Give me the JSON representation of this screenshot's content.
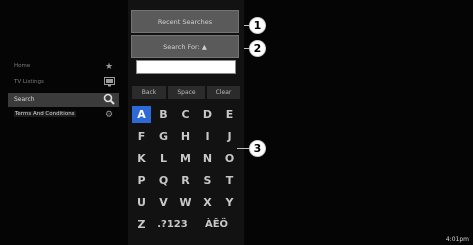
{
  "sidebar": {
    "items": [
      {
        "label": "Home",
        "icon": "star-icon"
      },
      {
        "label": "TV Listings",
        "icon": "tv-icon"
      },
      {
        "label": "Search",
        "icon": "magnifier-icon"
      },
      {
        "label": "Terms And Conditions",
        "icon": "settings-gear-icon"
      }
    ]
  },
  "panel": {
    "recent_label": "Recent Searches",
    "search_for_label": "Search For: ▲",
    "search_value": "",
    "controls": {
      "back": "Back",
      "space": "Space",
      "clear": "Clear"
    },
    "rows": [
      [
        "A",
        "B",
        "C",
        "D",
        "E"
      ],
      [
        "F",
        "G",
        "H",
        "I",
        "J"
      ],
      [
        "K",
        "L",
        "M",
        "N",
        "O"
      ],
      [
        "P",
        "Q",
        "R",
        "S",
        "T"
      ],
      [
        "U",
        "V",
        "W",
        "X",
        "Y"
      ],
      [
        "Z",
        ".?123",
        "ÀÊÖ"
      ]
    ],
    "selected_key": "A"
  },
  "callouts": [
    "1",
    "2",
    "3"
  ],
  "status": {
    "clock": "4:01pm"
  },
  "colors": {
    "background": "#050505",
    "selection": "#2d6ad8",
    "button": "#5a5a5a"
  }
}
